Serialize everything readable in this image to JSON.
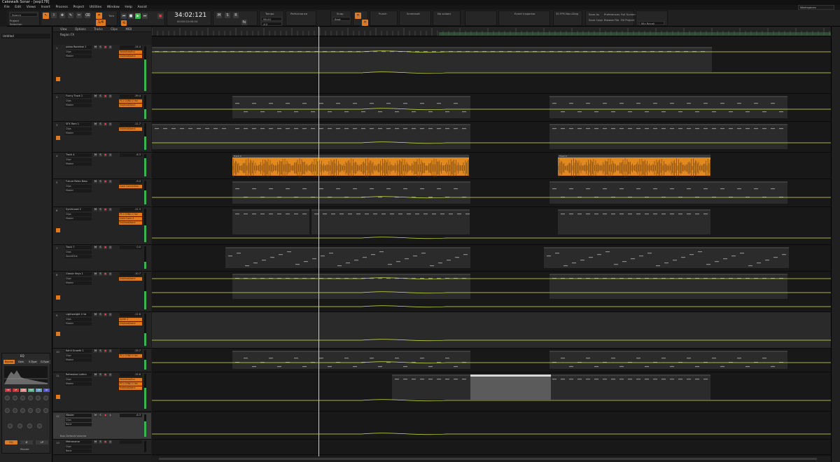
{
  "window": {
    "title": "Cakewalk Sonar - [exp178]"
  },
  "menu": [
    "File",
    "Edit",
    "Views",
    "Insert",
    "Process",
    "Project",
    "Utilities",
    "Window",
    "Help",
    "Assist"
  ],
  "workspace": "Workspaces",
  "control_bar": {
    "timecode": "34:02:121",
    "timecode_sub": "00:00:22:00.04",
    "tempo_label": "Tempo",
    "performance_label": "Performance",
    "snap_label": "Snap",
    "punch_label": "Punch",
    "loop_label": "Loop",
    "screenset_label": "Screenset",
    "event_inspector_label": "Event Inspector",
    "fps_label": "30 FPS Non-Drop",
    "not_soloed": "No soloed",
    "save_as": "Save As",
    "save_copy": "Save Copy",
    "preferences": "Preferences",
    "browse_file": "Browse File",
    "full_screen": "Full Screen",
    "fill_project": "Fill Project",
    "mix_recall": "Mix Recall"
  },
  "inspector": {
    "title": "Untitled",
    "eq_tabs": [
      "Bypass",
      "Gain",
      "E-Type",
      "G-Type"
    ],
    "out_label": "Master"
  },
  "track_bar": {
    "items": [
      "View",
      "Options",
      "Tracks",
      "Clips",
      "MIDI",
      "Region FX"
    ]
  },
  "tracks": [
    {
      "num": "1",
      "name": "Jubba Rockfest 1",
      "value": "-14.4",
      "output": "Master",
      "fx": [
        "VoiceAutoEnv",
        "Vst/mod/band"
      ],
      "meter": 0.7
    },
    {
      "num": "2",
      "name": "Funny Track 1",
      "value": "-39.4",
      "output": "Master",
      "fx": [
        "PC1 COND 2 Vol",
        "Vst/mod/band"
      ],
      "meter": 0.4
    },
    {
      "num": "3",
      "name": "SFX Ram 1",
      "value": "-11.7",
      "output": "Master",
      "fx": [
        "Vst/mod/band"
      ],
      "meter": 0.5
    },
    {
      "num": "4",
      "name": "Track 4",
      "value": "-6.3",
      "output": "Master",
      "fx": [],
      "meter": 0.8
    },
    {
      "num": "5",
      "name": "Future Retro Bass",
      "value": "-9.4",
      "output": "Master",
      "fx": [
        "Cone Connection"
      ],
      "meter": 0.6
    },
    {
      "num": "6",
      "name": "SynthLead 2",
      "value": "-11.3",
      "output": "Master",
      "fx": [
        "PC1 COND 2 Vol",
        "Cone Conn 2",
        "Vst/mod/band"
      ],
      "meter": 0.5
    },
    {
      "num": "7",
      "name": "Track 7",
      "value": "0.0",
      "output": "SoundOne",
      "fx": [],
      "meter": 0.3
    },
    {
      "num": "8",
      "name": "Classic Keys 1",
      "value": "-10.7",
      "output": "Master",
      "fx": [
        "Vst/mod/band"
      ],
      "meter": 0.5
    },
    {
      "num": "9",
      "name": "Lightweight 4 Va",
      "value": "-11.8",
      "output": "Master",
      "fx": [
        "Synth 2",
        "Vst/mod/band"
      ],
      "meter": 0.4
    },
    {
      "num": "10",
      "name": "Kahli Growth 1",
      "value": "-15.7",
      "output": "Master",
      "fx": [
        "PC1 COND 2 Vol"
      ],
      "meter": 0.5
    },
    {
      "num": "11",
      "name": "Refreshed Lofrim",
      "value": "-15.6",
      "output": "Master",
      "fx": [
        "VoiceAutoEnv",
        "PC1 COND 2 Vol",
        "Vst/mod/band"
      ],
      "meter": 0.6
    },
    {
      "num": "12",
      "name": "Master",
      "value": "-6.3",
      "output": "None",
      "fx": [],
      "meter": 0.7
    },
    {
      "num": "13",
      "name": "Metronome",
      "value": "",
      "output": "None",
      "fx": [],
      "meter": 0.0
    }
  ],
  "bus_label": "Bus Default Volume",
  "clip_labels": {
    "audio": "Track 4"
  },
  "colors": {
    "accent": "#e07a22",
    "bg": "#1c1c1c",
    "automation": "#d6e84a",
    "play": "#39b54a"
  }
}
